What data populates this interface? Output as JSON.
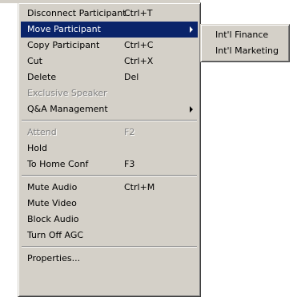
{
  "context_menu": {
    "items": [
      {
        "label": "Disconnect Participant",
        "shortcut": "Ctrl+T"
      },
      {
        "label": "Move Participant",
        "shortcut": ""
      },
      {
        "label": "Copy Participant",
        "shortcut": "Ctrl+C"
      },
      {
        "label": "Cut",
        "shortcut": "Ctrl+X"
      },
      {
        "label": "Delete",
        "shortcut": "Del"
      },
      {
        "label": "Exclusive Speaker",
        "shortcut": ""
      },
      {
        "label": "Q&A Management",
        "shortcut": ""
      },
      {
        "label": "Attend",
        "shortcut": "F2"
      },
      {
        "label": "Hold",
        "shortcut": ""
      },
      {
        "label": "To Home Conf",
        "shortcut": "F3"
      },
      {
        "label": "Mute Audio",
        "shortcut": "Ctrl+M"
      },
      {
        "label": "Mute Video",
        "shortcut": ""
      },
      {
        "label": "Block Audio",
        "shortcut": ""
      },
      {
        "label": "Turn Off AGC",
        "shortcut": ""
      },
      {
        "label": "Properties...",
        "shortcut": ""
      }
    ],
    "highlighted_item": "Move Participant",
    "disabled_items": [
      "Exclusive Speaker",
      "Attend"
    ]
  },
  "submenu": {
    "items": [
      {
        "label": "Int'l Finance"
      },
      {
        "label": "Int'l Marketing"
      }
    ]
  },
  "colors": {
    "menu_background": "#d4d0c8",
    "highlight": "#0a246a",
    "disabled_text": "#808080"
  },
  "icons": {
    "submenu_arrow": "triangle-right"
  }
}
